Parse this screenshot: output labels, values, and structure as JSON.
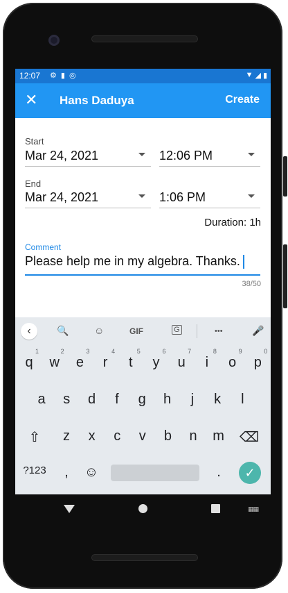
{
  "status_bar": {
    "time": "12:07",
    "icons": [
      "settings-icon",
      "sd-card-icon",
      "sync-icon"
    ],
    "right_icons": [
      "wifi-icon",
      "signal-icon",
      "battery-icon"
    ]
  },
  "app_bar": {
    "close_glyph": "✕",
    "title": "Hans Daduya",
    "action": "Create"
  },
  "form": {
    "start": {
      "label": "Start",
      "date": "Mar 24, 2021",
      "time": "12:06 PM"
    },
    "end": {
      "label": "End",
      "date": "Mar 24, 2021",
      "time": "1:06 PM"
    },
    "duration": "Duration: 1h",
    "comment": {
      "label": "Comment",
      "value": "Please help me in my algebra. Thanks.",
      "counter": "38/50"
    }
  },
  "keyboard": {
    "toolbar": {
      "back": "‹",
      "search": "🔍",
      "sticker": "☺",
      "gif": "GIF",
      "translate": "G",
      "more": "•••",
      "mic": "🎤"
    },
    "row1": [
      {
        "k": "q",
        "h": "1"
      },
      {
        "k": "w",
        "h": "2"
      },
      {
        "k": "e",
        "h": "3"
      },
      {
        "k": "r",
        "h": "4"
      },
      {
        "k": "t",
        "h": "5"
      },
      {
        "k": "y",
        "h": "6"
      },
      {
        "k": "u",
        "h": "7"
      },
      {
        "k": "i",
        "h": "8"
      },
      {
        "k": "o",
        "h": "9"
      },
      {
        "k": "p",
        "h": "0"
      }
    ],
    "row2": [
      "a",
      "s",
      "d",
      "f",
      "g",
      "h",
      "j",
      "k",
      "l"
    ],
    "row3": [
      "z",
      "x",
      "c",
      "v",
      "b",
      "n",
      "m"
    ],
    "shift": "⇧",
    "backspace": "⌫",
    "symbols": "?123",
    "comma": ",",
    "emoji": "☺",
    "period": ".",
    "enter": "✓"
  },
  "nav": {
    "keyboard_switch": "▦▦"
  }
}
